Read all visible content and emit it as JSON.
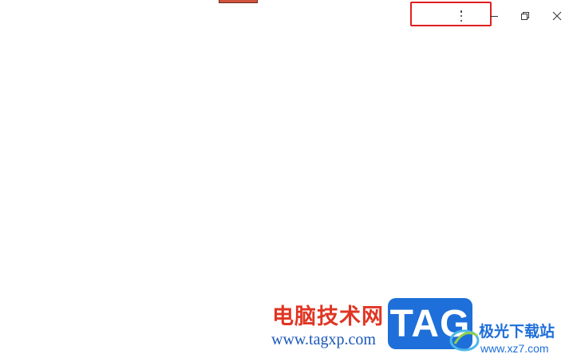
{
  "colors": {
    "highlight": "#e02020",
    "tab": "#d0533b",
    "watermark_red": "#e03524",
    "watermark_blue": "#1e6fd9"
  },
  "titlebar": {
    "menu_icon": "more-vertical-icon",
    "minimize_icon": "minimize-icon",
    "restore_icon": "restore-icon",
    "close_icon": "close-icon"
  },
  "watermark": {
    "cn_title": "电脑技术网",
    "url": "www.tagxp.com",
    "badge": "TAG",
    "site_name": "极光下载站",
    "site_url": "www.xz7.com"
  }
}
